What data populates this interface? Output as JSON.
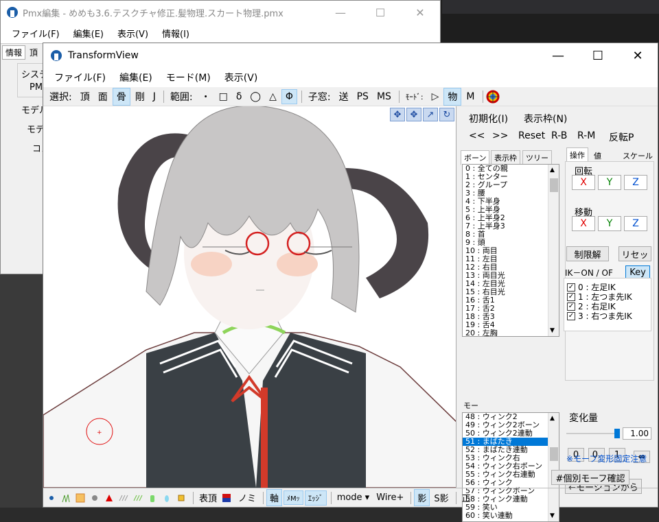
{
  "pmx_window": {
    "title": "Pmx編集 - めめも3.6.テスクチャ修正.髪物理.スカート物理.pmx",
    "menu": [
      "ファイル(F)",
      "編集(E)",
      "表示(V)",
      "情報(I)"
    ],
    "tabs": [
      "情報",
      "頂"
    ],
    "labels": [
      "システ",
      "PM",
      "モデル",
      "モデ",
      "コメ"
    ]
  },
  "transform_view": {
    "title": "TransformView",
    "menu": [
      "ファイル(F)",
      "編集(E)",
      "モード(M)",
      "表示(V)"
    ],
    "toolbar": {
      "select_label": "選択:",
      "select_items": [
        "頂",
        "面",
        "骨",
        "剛",
        "J"
      ],
      "range_label": "範囲:",
      "range_items": [
        "・",
        "□",
        "δ",
        "◯",
        "△",
        "Φ"
      ],
      "child_label": "子窓:",
      "child_items": [
        "送",
        "PS",
        "MS"
      ],
      "mode_label": "ﾓｰﾄﾞ:",
      "mode_items": [
        "▷",
        "物",
        "M"
      ]
    },
    "viewport_tools": [
      "✥",
      "✥",
      "↗",
      "↻"
    ],
    "right_panel": {
      "init_button": "初期化(I)",
      "display_frame_button": "表示枠(N)",
      "nav_buttons": [
        "<<",
        ">>",
        "Reset",
        "R-B",
        "R-M",
        "反転P"
      ],
      "bone_tabs": [
        "ボーン",
        "表示枠",
        "ツリー"
      ],
      "op_tabs": [
        "操作",
        "値",
        "スケール"
      ],
      "rotation_label": "回転",
      "move_label": "移動",
      "axes": [
        "X",
        "Y",
        "Z"
      ],
      "limit_release": "制限解",
      "reset": "リセッ",
      "ik_label": "IK－ON / OF",
      "key_button": "Key",
      "ik_items": [
        "0 : 左足IK",
        "1 : 左つま先IK",
        "2 : 右足IK",
        "3 : 右つま先IK"
      ],
      "bones": [
        "0 : 全ての親",
        "1 : センター",
        "2 : グループ",
        "3 : 腰",
        "4 : 下半身",
        "5 : 上半身",
        "6 : 上半身2",
        "7 : 上半身3",
        "8 : 首",
        "9 : 頭",
        "10 : 両目",
        "11 : 左目",
        "12 : 右目",
        "13 : 両目光",
        "14 : 左目光",
        "15 : 右目光",
        "16 : 舌1",
        "17 : 舌2",
        "18 : 舌3",
        "19 : 舌4",
        "20 : 左胸"
      ],
      "morph_label": "モー",
      "morphs": [
        "48 : ウィンク2",
        "49 : ウィンク2ボーン",
        "50 : ウィンク2連動",
        "51 : まばたき",
        "52 : まばたき連動",
        "53 : ウィンク右",
        "54 : ウィンク右ボーン",
        "55 : ウィンク右連動",
        "56 : ウィンク",
        "57 : ウィンクボーン",
        "58 : ウィンク連動",
        "59 : 笑い",
        "60 : 笑い連動"
      ],
      "selected_morph": "51 : まばたき",
      "change_amount_label": "変化量",
      "change_value": "1.00",
      "small_buttons": [
        "0",
        "0.",
        "1",
        "⇔"
      ],
      "motion_button": "←モーションから",
      "morph_note": "※モーフ変形固定注意",
      "individual_morph_button": "#個別モーフ確認"
    },
    "status_bar": {
      "icons": [
        "dot-icon",
        "grass-icon",
        "texture-icon",
        "circle-icon",
        "triangle-icon",
        "lines-icon",
        "green-lines-icon",
        "bottle-icon",
        "drop-icon",
        "cube-icon"
      ],
      "items": [
        "表頂",
        "ノミ",
        "軸",
        "ﾒMｯ",
        "ｴｯｼﾞ",
        "mode ▾",
        "Wire+",
        "影",
        "S影",
        "正"
      ]
    },
    "colors": {
      "selection": "#0078d7",
      "toggle_on": "#cde6f7",
      "x_axis": "#e00000",
      "y_axis": "#008000",
      "z_axis": "#0050d0"
    }
  }
}
